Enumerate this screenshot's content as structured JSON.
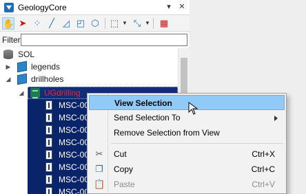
{
  "window": {
    "title": "GeologyCore",
    "pin_icon": "pin-icon",
    "close_icon": "close-icon"
  },
  "toolbar": {
    "buttons": [
      {
        "name": "pan-tool",
        "icon": "hand-icon",
        "glyph": "✋"
      },
      {
        "name": "select-tool",
        "icon": "pointer-icon",
        "glyph": "➤"
      },
      {
        "name": "select-points-tool",
        "icon": "points-icon",
        "glyph": "⁘"
      },
      {
        "name": "select-line-tool",
        "icon": "line-icon",
        "glyph": "╱"
      },
      {
        "name": "select-polygon-tool",
        "icon": "polygon-icon",
        "glyph": "◿"
      },
      {
        "name": "select-box-tool",
        "icon": "box-icon",
        "glyph": "◰"
      },
      {
        "name": "select-object-tool",
        "icon": "cube-select-icon",
        "glyph": "⬡"
      },
      {
        "name": "selection-mode-dropdown",
        "icon": "dashed-box-icon",
        "glyph": "⬚"
      },
      {
        "name": "transform-dropdown",
        "icon": "transform-icon",
        "glyph": "⤡"
      },
      {
        "name": "grid-tool",
        "icon": "grid-icon",
        "glyph": "▦"
      }
    ]
  },
  "filter": {
    "label": "Filter",
    "value": "",
    "placeholder": ""
  },
  "tree": {
    "root": {
      "label": "SOL",
      "icon": "database-icon"
    },
    "items": [
      {
        "label": "legends",
        "icon": "cube-icon",
        "expanded": false
      },
      {
        "label": "drillholes",
        "icon": "cube-icon",
        "expanded": true
      }
    ],
    "group": {
      "label": "UGdrilling",
      "icon": "drillhole-set-icon"
    },
    "holes": [
      "MSC-00",
      "MSC-00",
      "MSC-00",
      "MSC-00",
      "MSC-00",
      "MSC-00",
      "MSC-00",
      "MSC-00"
    ],
    "hole_icon": "drillhole-icon"
  },
  "context_menu": {
    "items": [
      {
        "label": "View Selection",
        "shortcut": "",
        "highlighted": true,
        "disabled": false,
        "submenu": false,
        "icon": ""
      },
      {
        "label": "Send Selection To",
        "shortcut": "",
        "highlighted": false,
        "disabled": false,
        "submenu": true,
        "icon": ""
      },
      {
        "label": "Remove Selection from View",
        "shortcut": "",
        "highlighted": false,
        "disabled": false,
        "submenu": false,
        "icon": ""
      },
      {
        "label": "Cut",
        "shortcut": "Ctrl+X",
        "highlighted": false,
        "disabled": false,
        "submenu": false,
        "icon": "scissors-icon"
      },
      {
        "label": "Copy",
        "shortcut": "Ctrl+C",
        "highlighted": false,
        "disabled": false,
        "submenu": false,
        "icon": "copy-icon"
      },
      {
        "label": "Paste",
        "shortcut": "Ctrl+V",
        "highlighted": false,
        "disabled": true,
        "submenu": false,
        "icon": "paste-icon"
      }
    ]
  },
  "colors": {
    "selection_bg": "#0a246a",
    "menu_highlight": "#91c9f7",
    "group_label": "#e8292e"
  }
}
